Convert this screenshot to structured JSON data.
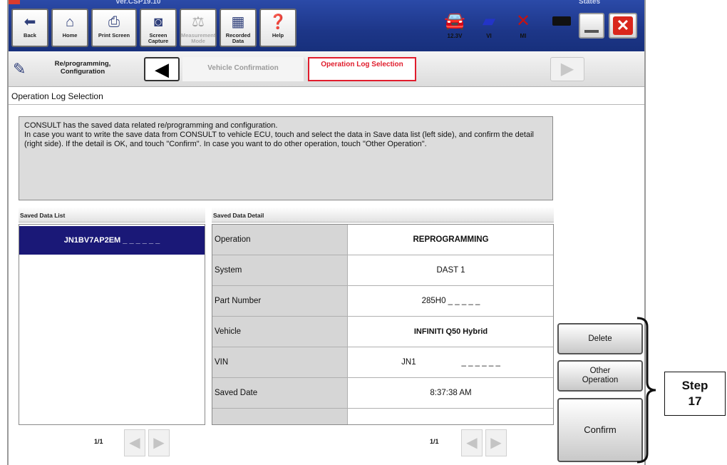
{
  "window": {
    "title_left": "Ver.CSP19.10",
    "title_right": "States"
  },
  "toolbar": {
    "buttons": [
      {
        "label": "Back",
        "icon": "back-arrow-icon"
      },
      {
        "label": "Home",
        "icon": "home-icon"
      },
      {
        "label": "Print Screen",
        "icon": "printer-icon"
      },
      {
        "label": "Screen Capture",
        "icon": "camera-icon"
      },
      {
        "label": "Measurement Mode",
        "icon": "measurement-icon"
      },
      {
        "label": "Recorded Data",
        "icon": "recorded-data-icon"
      },
      {
        "label": "Help",
        "icon": "help-icon"
      }
    ],
    "status": {
      "battery": "12.3V",
      "vi": "VI",
      "mi": "MI"
    }
  },
  "breadcrumb": {
    "home": "Re/programming, Configuration",
    "vehicle": "Vehicle Confirmation",
    "current": "Operation Log Selection"
  },
  "page": {
    "title": "Operation Log Selection",
    "message": "CONSULT has the saved data related re/programming and configuration.\nIn case you want to write the save data from CONSULT to vehicle ECU, touch and select the data in Save data list (left side), and confirm the detail (right side). If the detail is OK, and touch \"Confirm\".  In case you want to do other operation, touch \"Other Operation\"."
  },
  "saved_list": {
    "header": "Saved Data List",
    "items": [
      "JN1BV7AP2EM _ _ _ _ _ _"
    ],
    "page": "1/1"
  },
  "saved_detail": {
    "header": "Saved Data Detail",
    "rows": [
      {
        "label": "Operation",
        "value": "REPROGRAMMING"
      },
      {
        "label": "System",
        "value": "DAST 1"
      },
      {
        "label": "Part Number",
        "value": "285H0 _ _ _ _ _"
      },
      {
        "label": "Vehicle",
        "value": "INFINITI Q50 Hybrid"
      },
      {
        "label": "VIN",
        "value": "JN1                    _ _ _ _ _ _"
      },
      {
        "label": "Saved Date",
        "value": "8:37:38 AM"
      }
    ],
    "page": "1/1"
  },
  "actions": {
    "delete": "Delete",
    "other_operation": "Other Operation",
    "confirm": "Confirm"
  },
  "annotation": {
    "step": "Step 17"
  }
}
